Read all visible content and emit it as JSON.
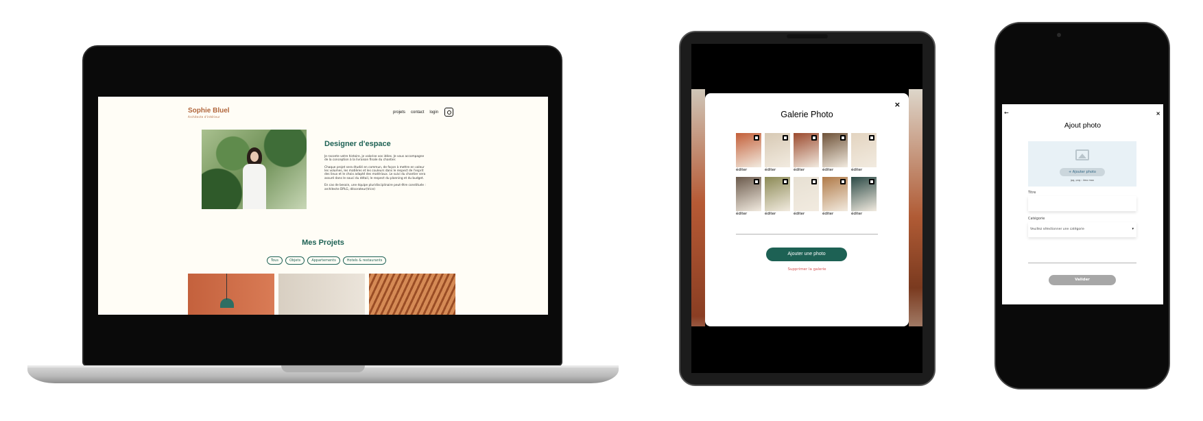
{
  "laptop": {
    "logo": "Sophie Bluel",
    "logo_sub": "Architecte d'intérieur",
    "nav": {
      "projects": "projets",
      "contact": "contact",
      "login": "login"
    },
    "intro": {
      "title": "Designer d'espace",
      "p1": "Je raconte votre histoire, je valorise vos idées. Je vous accompagne de la conception à la livraison finale du chantier.",
      "p2": "Chaque projet sera étudié en commun, de façon à mettre en valeur les volumes, les matières et les couleurs dans le respect de l'esprit des lieux et le choix adapté des matériaux. Le suivi du chantier sera assuré dans le souci du détail, le respect du planning et du budget.",
      "p3": "En cas de besoin, une équipe pluridisciplinaire peut-être constituée : architecte DPLG, décorateur(trice)"
    },
    "projects_title": "Mes Projets",
    "filters": [
      "Tous",
      "Objets",
      "Appartements",
      "Hotels & restaurants"
    ]
  },
  "tablet": {
    "modal_title": "Galerie Photo",
    "close": "×",
    "edit_label": "éditer",
    "thumb_colors": [
      "#c35f39",
      "#d7c9b4",
      "#9b4a2e",
      "#6e5238",
      "#e3d4c0",
      "#6b5a4c",
      "#8c8a56",
      "#e7e0d3",
      "#b07a48",
      "#2b4a46"
    ],
    "add_button": "Ajouter une photo",
    "delete_link": "Supprimer la galerie"
  },
  "phone": {
    "back": "←",
    "close": "×",
    "title": "Ajout photo",
    "upload_button": "+ Ajouter photo",
    "upload_hint": "jpg, png : 4mo max",
    "title_label": "Titre",
    "category_label": "Catégorie",
    "category_placeholder": "Veuillez sélectionner une catégorie",
    "validate_button": "Valider"
  },
  "colors": {
    "brand": "#1d6154",
    "accent": "#b1663c",
    "danger": "#d65353",
    "background": "#fffdf6"
  }
}
